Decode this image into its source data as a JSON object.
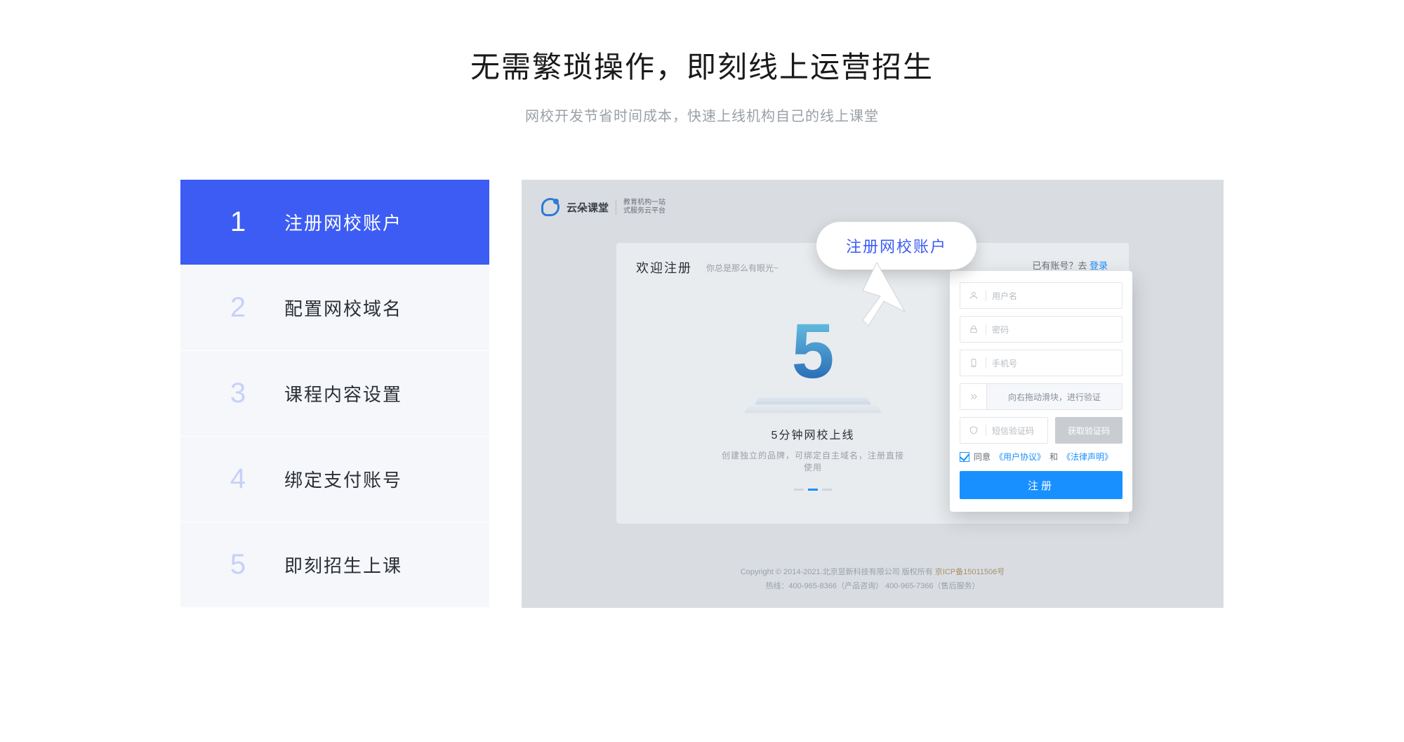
{
  "page": {
    "title": "无需繁琐操作，即刻线上运营招生",
    "subtitle": "网校开发节省时间成本，快速上线机构自己的线上课堂"
  },
  "steps": [
    {
      "num": "1",
      "label": "注册网校账户",
      "active": true
    },
    {
      "num": "2",
      "label": "配置网校域名",
      "active": false
    },
    {
      "num": "3",
      "label": "课程内容设置",
      "active": false
    },
    {
      "num": "4",
      "label": "绑定支付账号",
      "active": false
    },
    {
      "num": "5",
      "label": "即刻招生上课",
      "active": false
    }
  ],
  "preview": {
    "logo_text": "云朵课堂",
    "logo_sub1": "教育机构一站",
    "logo_sub2": "式服务云平台",
    "welcome": "欢迎注册",
    "welcome_sub": "你总是那么有眼光~",
    "have_account_text": "已有账号？去 ",
    "login_link": "登录",
    "illus": {
      "title": "5分钟网校上线",
      "sub": "创建独立的品牌，可绑定自主域名，注册直接使用"
    },
    "form": {
      "username_ph": "用户名",
      "password_ph": "密码",
      "phone_ph": "手机号",
      "slider_text": "向右拖动滑块，进行验证",
      "sms_ph": "短信验证码",
      "get_code": "获取验证码",
      "agree_prefix": "同意",
      "user_agreement": "《用户协议》",
      "and": "和",
      "legal": "《法律声明》",
      "submit": "注册"
    },
    "bubble": "注册网校账户",
    "footer": {
      "line1_pre": "Copyright © 2014-2021.北京昱新科技有限公司  版权所有   ",
      "icp": "京ICP备15011506号",
      "line2": "热线：400-965-8366（产品咨询）  400-965-7366（售后服务）"
    }
  }
}
